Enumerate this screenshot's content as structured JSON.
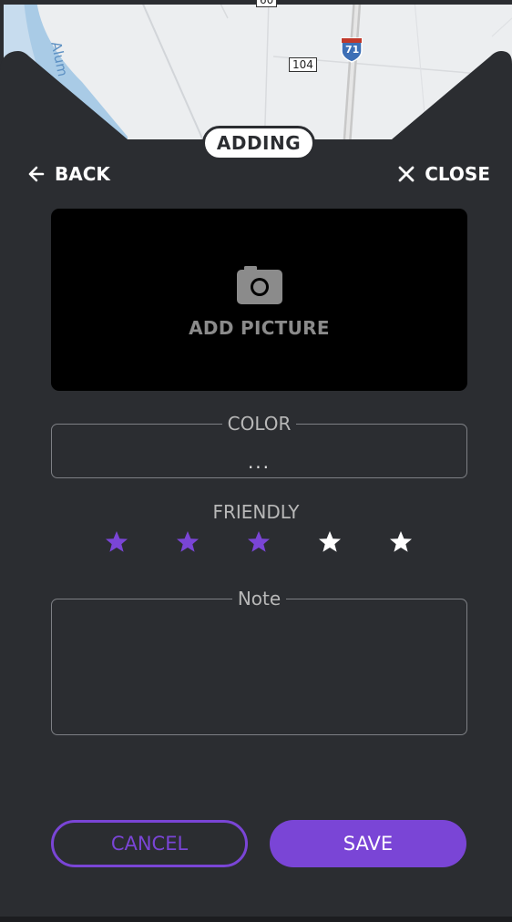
{
  "map": {
    "road_badge_104": "104",
    "interstate_shield": "71",
    "water_label": "Alum",
    "top_badge": "60"
  },
  "header": {
    "mode_label": "ADDING",
    "back_label": "BACK",
    "close_label": "CLOSE"
  },
  "picture": {
    "label": "ADD PICTURE"
  },
  "color_field": {
    "legend": "COLOR",
    "value": "..."
  },
  "friendly": {
    "label": "FRIENDLY",
    "rating": 3,
    "max": 5,
    "active_color": "#7a45d6",
    "inactive_color": "#ffffff"
  },
  "note_field": {
    "legend": "Note",
    "value": ""
  },
  "actions": {
    "cancel_label": "CANCEL",
    "save_label": "SAVE"
  },
  "colors": {
    "panel": "#2b2d31",
    "accent": "#7a45d6"
  }
}
